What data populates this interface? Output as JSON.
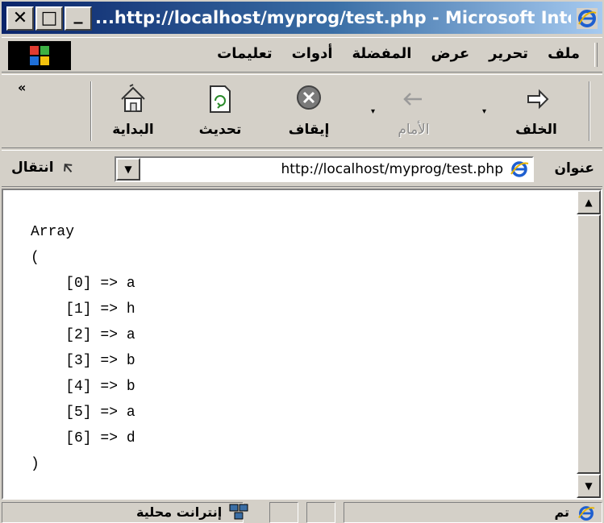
{
  "window": {
    "title": "...http://localhost/myprog/test.php - Microsoft Inter",
    "controls": {
      "close": "✕",
      "maximize": "□",
      "minimize": "_"
    }
  },
  "menu": {
    "items": [
      "ملف",
      "تحرير",
      "عرض",
      "المفضلة",
      "أدوات",
      "تعليمات"
    ]
  },
  "toolbar": {
    "overflow": "«",
    "back": "الخلف",
    "forward": "الأمام",
    "stop": "إيقاف",
    "refresh": "تحديث",
    "home": "البداية"
  },
  "address": {
    "label": "عنوان",
    "url": "http://localhost/myprog/test.php",
    "go": "انتقال"
  },
  "content": {
    "output": "Array\n(\n    [0] => a\n    [1] => h\n    [2] => a\n    [3] => b\n    [4] => b\n    [5] => a\n    [6] => d\n)"
  },
  "status": {
    "done": "تم",
    "zone": "إنترانت محلية"
  },
  "icons": [
    "close-icon",
    "maximize-icon",
    "minimize-icon",
    "ie-icon",
    "windows-flag-icon",
    "back-arrow-icon",
    "forward-arrow-icon",
    "stop-icon",
    "refresh-icon",
    "home-icon",
    "go-arrow-icon",
    "dropdown-icon",
    "scroll-up-icon",
    "scroll-down-icon",
    "intranet-icon"
  ]
}
